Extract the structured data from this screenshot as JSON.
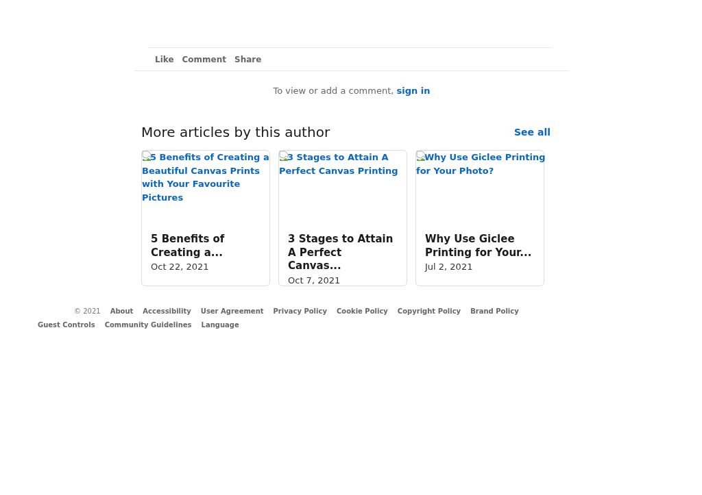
{
  "actions": [
    "Like",
    "Comment",
    "Share"
  ],
  "comment_prompt": {
    "text": "To view or add a comment,",
    "link": "sign in"
  },
  "more_articles": {
    "title": "More articles by this author",
    "see_all": "See all",
    "articles": [
      {
        "image_alt": "5 Benefits of Creating a Beautiful Canvas Prints with Your Favourite Pictures",
        "title": "5 Benefits of Creating a...",
        "date": "Oct 22, 2021"
      },
      {
        "image_alt": "3 Stages to Attain A Perfect Canvas Printing",
        "title": "3 Stages to Attain A Perfect Canvas...",
        "date": "Oct 7, 2021"
      },
      {
        "image_alt": "Why Use Giclee Printing for Your Photo?",
        "title": "Why Use Giclee Printing for Your...",
        "date": "Jul 2, 2021"
      }
    ]
  },
  "footer": {
    "copyright": "© 2021",
    "links": [
      "About",
      "Accessibility",
      "User Agreement",
      "Privacy Policy",
      "Cookie Policy",
      "Copyright Policy",
      "Brand Policy",
      "Guest Controls",
      "Community Guidelines",
      "Language"
    ]
  }
}
